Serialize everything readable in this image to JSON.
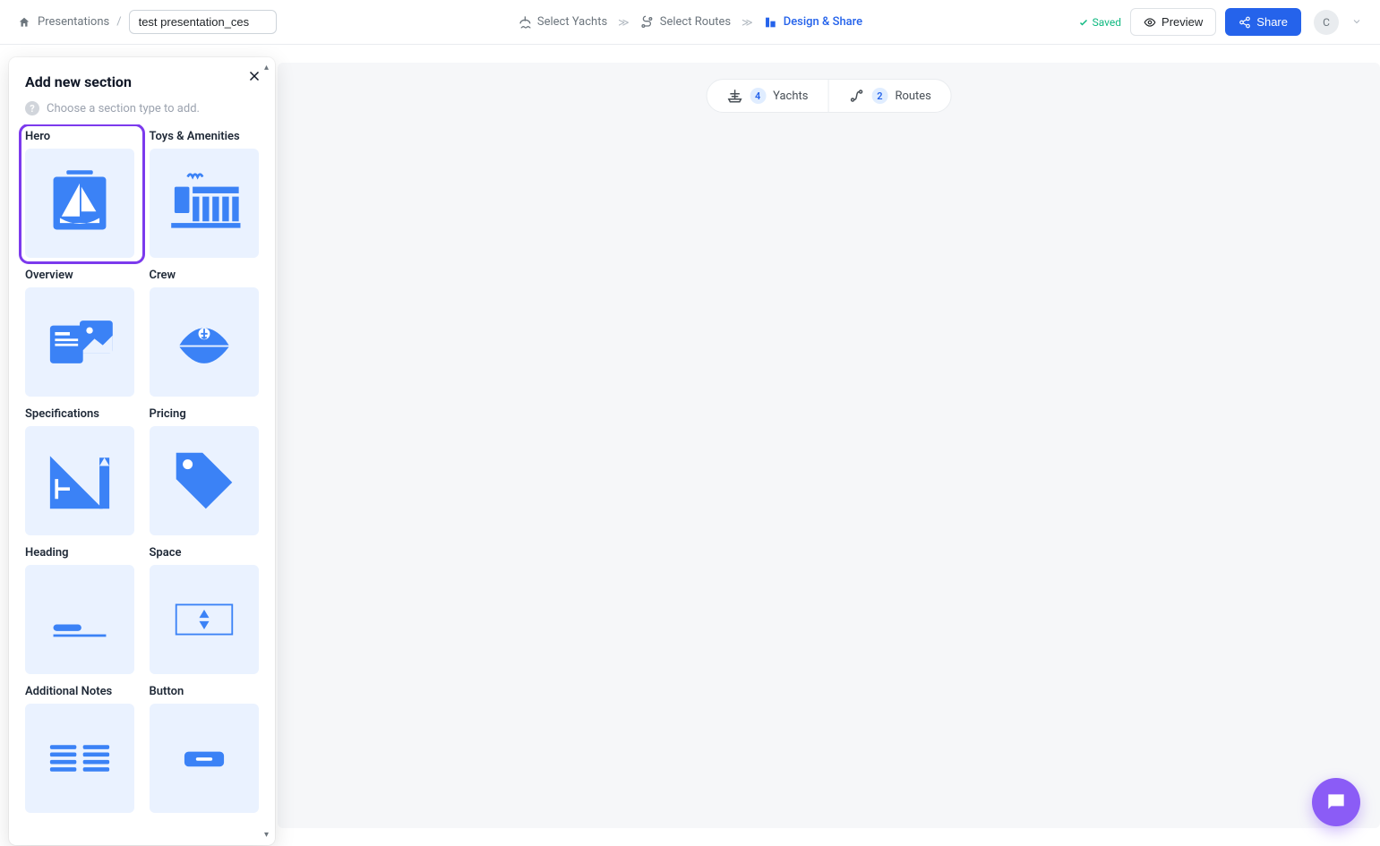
{
  "breadcrumb": {
    "label": "Presentations",
    "sep": "/"
  },
  "title_input": "test presentation_ces",
  "steps": {
    "yachts": "Select Yachts",
    "routes": "Select Routes",
    "design": "Design & Share"
  },
  "saved": "Saved",
  "preview": "Preview",
  "share": "Share",
  "avatar": "C",
  "pill": {
    "yacht_count": "4",
    "yacht_label": "Yachts",
    "route_count": "2",
    "route_label": "Routes"
  },
  "panel": {
    "title": "Add new section",
    "help": "Choose a section type to add.",
    "sections": {
      "hero": "Hero",
      "toys": "Toys & Amenities",
      "overview": "Overview",
      "crew": "Crew",
      "specs": "Specifications",
      "pricing": "Pricing",
      "heading": "Heading",
      "space": "Space",
      "notes": "Additional Notes",
      "button": "Button"
    }
  }
}
